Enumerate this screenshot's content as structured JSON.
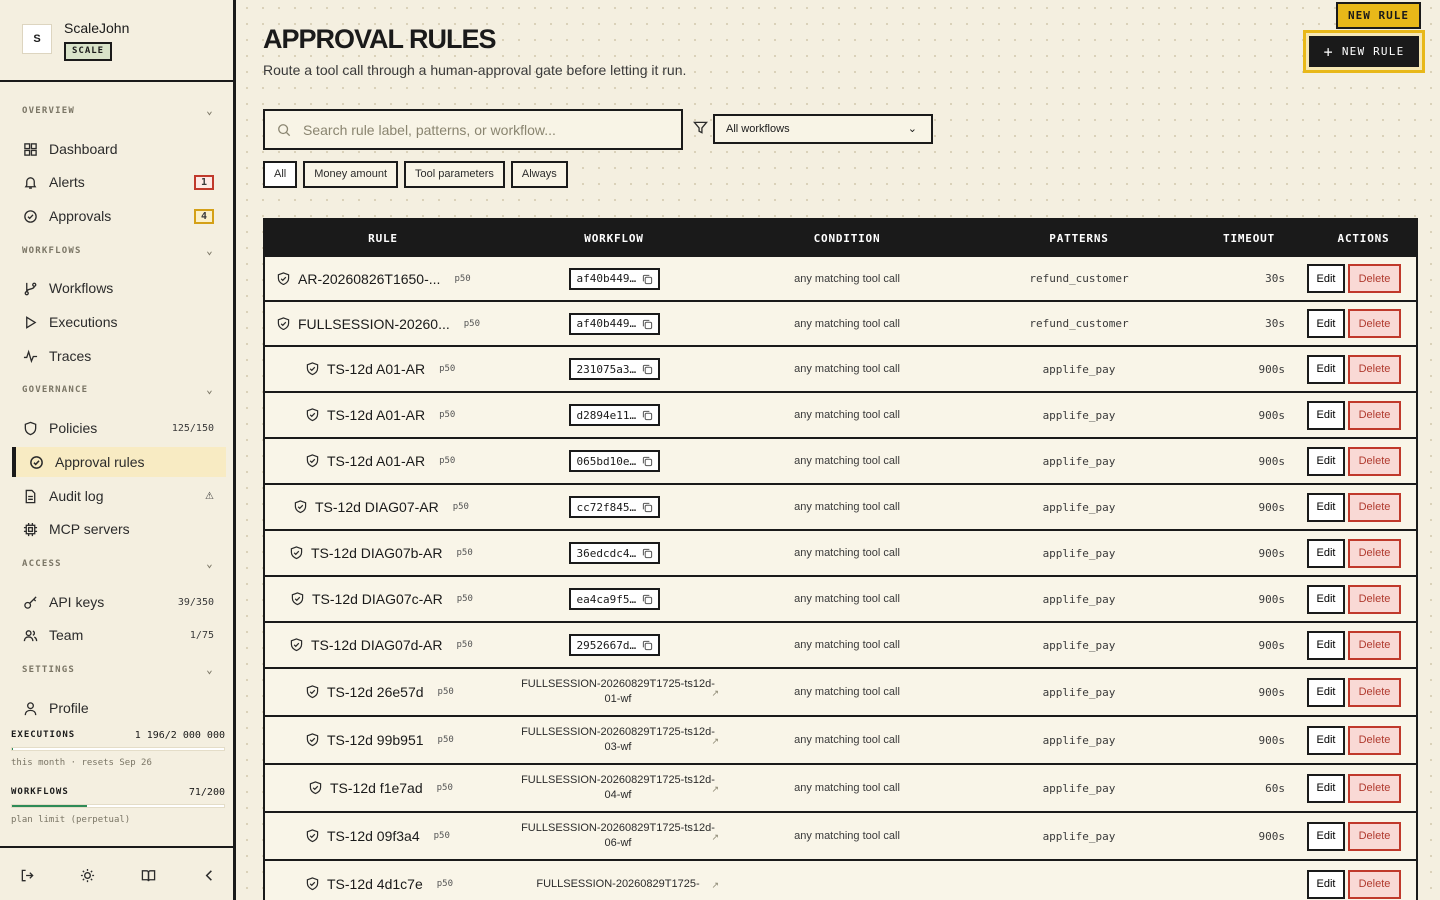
{
  "brand": {
    "avatar": "S",
    "name": "ScaleJohn",
    "badge": "SCALE"
  },
  "sidebar": {
    "sections": {
      "overview": "OVERVIEW",
      "workflows": "WORKFLOWS",
      "governance": "GOVERNANCE",
      "access": "ACCESS",
      "settings": "SETTINGS"
    },
    "items": {
      "dashboard": {
        "label": "Dashboard"
      },
      "alerts": {
        "label": "Alerts",
        "count": "1"
      },
      "approvals": {
        "label": "Approvals",
        "count": "4"
      },
      "workflows": {
        "label": "Workflows"
      },
      "executions": {
        "label": "Executions"
      },
      "traces": {
        "label": "Traces"
      },
      "policies": {
        "label": "Policies",
        "meta": "125/150"
      },
      "approval_rules": {
        "label": "Approval rules"
      },
      "audit_log": {
        "label": "Audit log"
      },
      "mcp_servers": {
        "label": "MCP servers"
      },
      "api_keys": {
        "label": "API keys",
        "meta": "39/350"
      },
      "team": {
        "label": "Team",
        "meta": "1/75"
      },
      "profile": {
        "label": "Profile"
      }
    },
    "usage": {
      "executions": {
        "label": "EXECUTIONS",
        "value": "1 196/2 000 000",
        "sub": "this month · resets Sep 26",
        "fraction": 0.0006
      },
      "workflows": {
        "label": "WORKFLOWS",
        "value": "71/200",
        "sub": "plan limit (perpetual)",
        "fraction": 0.355
      }
    }
  },
  "header": {
    "title": "APPROVAL RULES",
    "subtitle": "Route a tool call through a human-approval gate before letting it run.",
    "tag": "NEW RULE",
    "new_button": "NEW RULE"
  },
  "filters": {
    "search_placeholder": "Search rule label, patterns, or workflow...",
    "workflow_select": "All workflows",
    "chips": [
      "All",
      "Money amount",
      "Tool parameters",
      "Always"
    ]
  },
  "table": {
    "columns": {
      "rule": "RULE",
      "workflow": "WORKFLOW",
      "condition": "CONDITION",
      "patterns": "PATTERNS",
      "timeout": "TIMEOUT",
      "actions": "ACTIONS"
    },
    "edit_label": "Edit",
    "delete_label": "Delete",
    "rows": [
      {
        "rule": "AR-20260826T1650-...",
        "prio": "p50",
        "wf": "af40b449…",
        "wf_type": "id",
        "cond": "any matching tool call",
        "pat": "refund_customer",
        "to": "30s",
        "indent": 0
      },
      {
        "rule": "FULLSESSION-20260...",
        "prio": "p50",
        "wf": "af40b449…",
        "wf_type": "id",
        "cond": "any matching tool call",
        "pat": "refund_customer",
        "to": "30s",
        "indent": 0
      },
      {
        "rule": "TS-12d A01-AR",
        "prio": "p50",
        "wf": "231075a3…",
        "wf_type": "id",
        "cond": "any matching tool call",
        "pat": "applife_pay",
        "to": "900s",
        "indent": 29
      },
      {
        "rule": "TS-12d A01-AR",
        "prio": "p50",
        "wf": "d2894e11…",
        "wf_type": "id",
        "cond": "any matching tool call",
        "pat": "applife_pay",
        "to": "900s",
        "indent": 29
      },
      {
        "rule": "TS-12d A01-AR",
        "prio": "p50",
        "wf": "065bd10e…",
        "wf_type": "id",
        "cond": "any matching tool call",
        "pat": "applife_pay",
        "to": "900s",
        "indent": 29
      },
      {
        "rule": "TS-12d DIAG07-AR",
        "prio": "p50",
        "wf": "cc72f845…",
        "wf_type": "id",
        "cond": "any matching tool call",
        "pat": "applife_pay",
        "to": "900s",
        "indent": 17
      },
      {
        "rule": "TS-12d DIAG07b-AR",
        "prio": "p50",
        "wf": "36edcdc4…",
        "wf_type": "id",
        "cond": "any matching tool call",
        "pat": "applife_pay",
        "to": "900s",
        "indent": 13
      },
      {
        "rule": "TS-12d DIAG07c-AR",
        "prio": "p50",
        "wf": "ea4ca9f5…",
        "wf_type": "id",
        "cond": "any matching tool call",
        "pat": "applife_pay",
        "to": "900s",
        "indent": 14
      },
      {
        "rule": "TS-12d DIAG07d-AR",
        "prio": "p50",
        "wf": "2952667d…",
        "wf_type": "id",
        "cond": "any matching tool call",
        "pat": "applife_pay",
        "to": "900s",
        "indent": 13
      },
      {
        "rule": "TS-12d 26e57d",
        "prio": "p50",
        "wf": "FULLSESSION-20260829T1725-ts12d-01-wf",
        "wf_type": "name",
        "cond": "any matching tool call",
        "pat": "applife_pay",
        "to": "900s",
        "indent": 29
      },
      {
        "rule": "TS-12d 99b951",
        "prio": "p50",
        "wf": "FULLSESSION-20260829T1725-ts12d-03-wf",
        "wf_type": "name",
        "cond": "any matching tool call",
        "pat": "applife_pay",
        "to": "900s",
        "indent": 29
      },
      {
        "rule": "TS-12d f1e7ad",
        "prio": "p50",
        "wf": "FULLSESSION-20260829T1725-ts12d-04-wf",
        "wf_type": "name",
        "cond": "any matching tool call",
        "pat": "applife_pay",
        "to": "60s",
        "indent": 32
      },
      {
        "rule": "TS-12d 09f3a4",
        "prio": "p50",
        "wf": "FULLSESSION-20260829T1725-ts12d-06-wf",
        "wf_type": "name",
        "cond": "any matching tool call",
        "pat": "applife_pay",
        "to": "900s",
        "indent": 29
      },
      {
        "rule": "TS-12d 4d1c7e",
        "prio": "p50",
        "wf": "FULLSESSION-20260829T1725-",
        "wf_type": "name",
        "cond": "",
        "pat": "",
        "to": "",
        "indent": 29
      }
    ]
  }
}
